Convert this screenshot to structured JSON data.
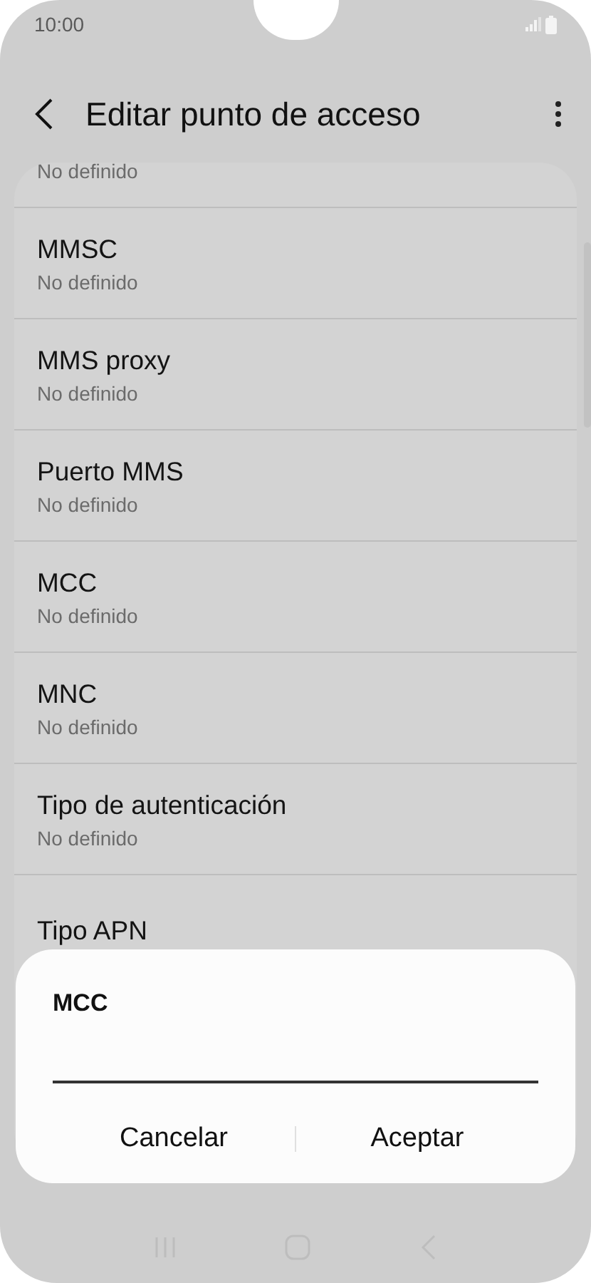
{
  "status_bar": {
    "time": "10:00"
  },
  "header": {
    "title": "Editar punto de acceso"
  },
  "settings": [
    {
      "subtitle": "No definido"
    },
    {
      "title": "MMSC",
      "subtitle": "No definido"
    },
    {
      "title": "MMS proxy",
      "subtitle": "No definido"
    },
    {
      "title": "Puerto MMS",
      "subtitle": "No definido"
    },
    {
      "title": "MCC",
      "subtitle": "No definido"
    },
    {
      "title": "MNC",
      "subtitle": "No definido"
    },
    {
      "title": "Tipo de autenticación",
      "subtitle": "No definido"
    },
    {
      "title": "Tipo APN"
    }
  ],
  "dialog": {
    "title": "MCC",
    "buttons": [
      "Cancelar",
      "Aceptar"
    ]
  }
}
